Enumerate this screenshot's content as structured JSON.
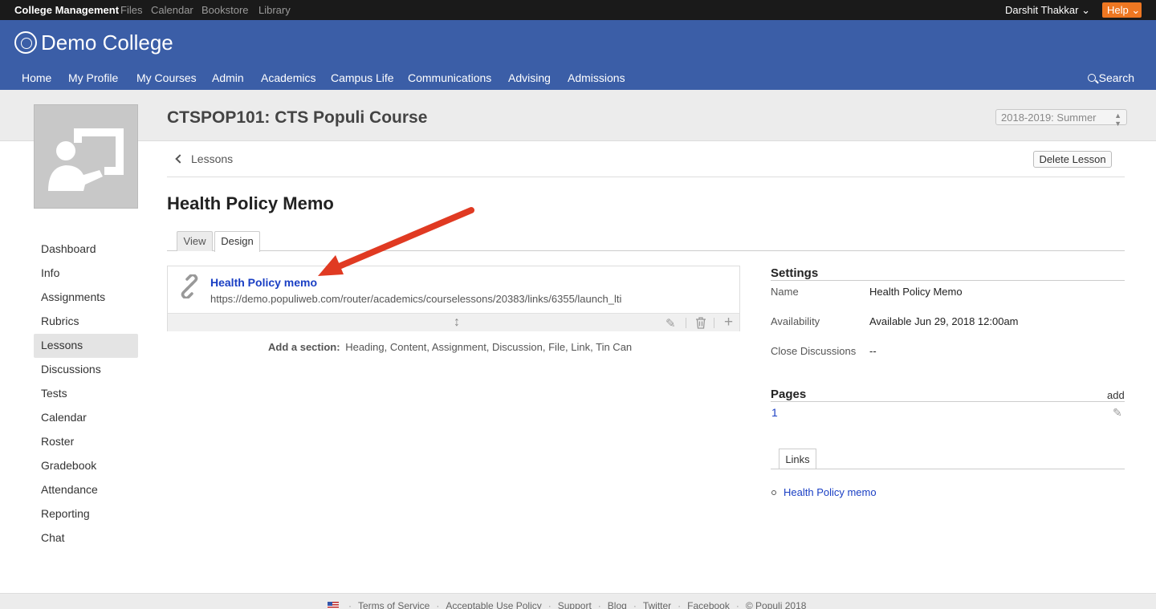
{
  "topbar": {
    "app_name": "College Management",
    "links": [
      "Files",
      "Calendar",
      "Bookstore",
      "Library"
    ],
    "user_name": "Darshit Thakkar ⌄",
    "help_label": "Help ⌄"
  },
  "header": {
    "college_name": "Demo College",
    "nav": [
      "Home",
      "My Profile",
      "My Courses",
      "Admin",
      "Academics",
      "Campus Life",
      "Communications",
      "Advising",
      "Admissions"
    ],
    "search_label": "Search"
  },
  "course": {
    "title": "CTSPOP101: CTS Populi Course",
    "term": "2018-2019: Summer"
  },
  "sidebar": {
    "items": [
      {
        "label": "Dashboard"
      },
      {
        "label": "Info"
      },
      {
        "label": "Assignments"
      },
      {
        "label": "Rubrics"
      },
      {
        "label": "Lessons"
      },
      {
        "label": "Discussions"
      },
      {
        "label": "Tests"
      },
      {
        "label": "Calendar"
      },
      {
        "label": "Roster"
      },
      {
        "label": "Gradebook"
      },
      {
        "label": "Attendance"
      },
      {
        "label": "Reporting"
      },
      {
        "label": "Chat"
      }
    ],
    "active": "Lessons"
  },
  "breadcrumb": {
    "label": "Lessons"
  },
  "delete_button": "Delete Lesson",
  "lesson": {
    "title": "Health Policy Memo",
    "tabs": [
      "View",
      "Design"
    ],
    "active_tab": "Design",
    "section": {
      "title": "Health Policy memo",
      "url": "https://demo.populiweb.com/router/academics/courselessons/20383/links/6355/launch_lti"
    },
    "add_section_label": "Add a section:",
    "add_section_options": "Heading, Content, Assignment, Discussion, File, Link, Tin Can"
  },
  "settings": {
    "heading": "Settings",
    "rows": [
      {
        "label": "Name",
        "value": "Health Policy Memo"
      },
      {
        "label": "Availability",
        "value": "Available Jun 29, 2018 12:00am"
      },
      {
        "label": "Close Discussions",
        "value": "--"
      }
    ]
  },
  "pages": {
    "heading": "Pages",
    "add_label": "add",
    "items": [
      "1"
    ]
  },
  "links_panel": {
    "tab_label": "Links",
    "items": [
      "Health Policy memo"
    ]
  },
  "footer": {
    "links": [
      "Terms of Service",
      "Acceptable Use Policy",
      "Support",
      "Blog",
      "Twitter",
      "Facebook",
      "© Populi 2018"
    ]
  },
  "colors": {
    "header_blue": "#3b5ea7",
    "help_orange": "#ee7722",
    "link_blue": "#1a3fc4",
    "annotation_red": "#e03a22"
  }
}
